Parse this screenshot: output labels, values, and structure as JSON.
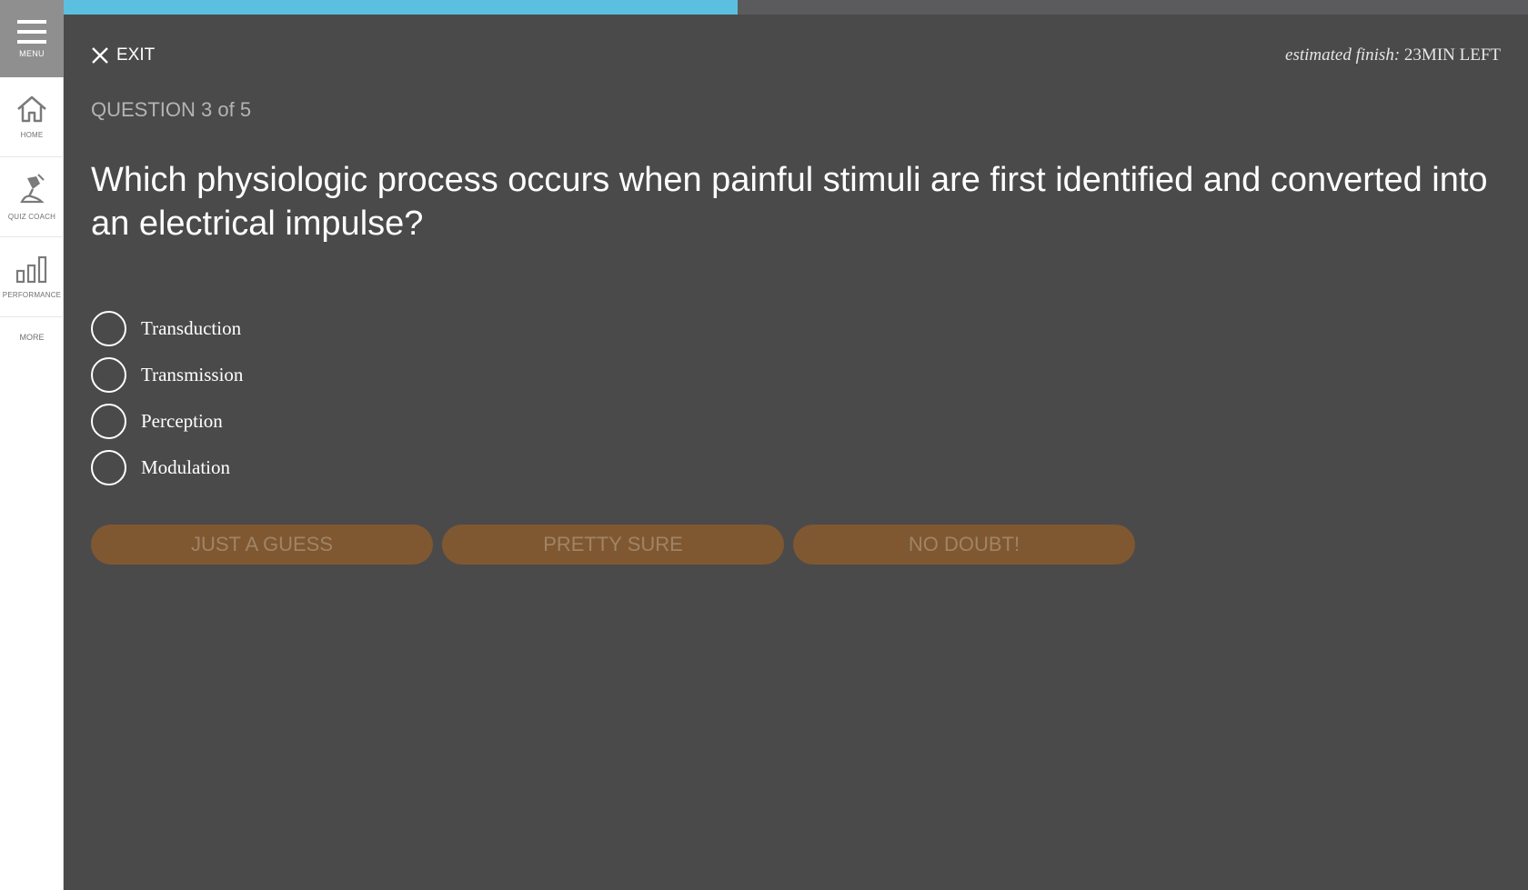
{
  "sidebar": {
    "menu_label": "MENU",
    "items": [
      {
        "label": "HOME",
        "icon": "home-icon"
      },
      {
        "label": "QUIZ COACH",
        "icon": "quiz-coach-icon"
      },
      {
        "label": "PERFORMANCE",
        "icon": "bar-chart-icon"
      }
    ],
    "more_label": "MORE"
  },
  "header": {
    "exit_label": "EXIT",
    "estimate_label": "estimated finish:",
    "estimate_value": "23MIN LEFT"
  },
  "progress": {
    "fraction": 0.46,
    "fill_color": "#5bc0df"
  },
  "question": {
    "counter": "QUESTION 3 of 5",
    "text": "Which physiologic process occurs when painful stimuli are first identified and converted into an electrical impulse?"
  },
  "options": [
    "Transduction",
    "Transmission",
    "Perception",
    "Modulation"
  ],
  "confidence_buttons": [
    "JUST A GUESS",
    "PRETTY SURE",
    "NO DOUBT!"
  ],
  "colors": {
    "background": "#4a4a4a",
    "button": "#7f5832",
    "button_text": "#a08466"
  }
}
